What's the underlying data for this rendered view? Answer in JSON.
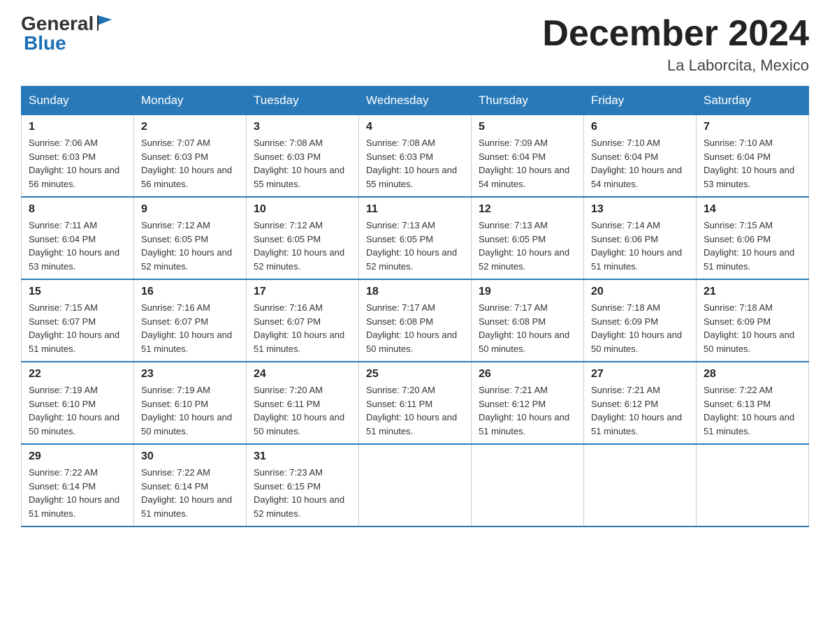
{
  "header": {
    "logo_general": "General",
    "logo_blue": "Blue",
    "title": "December 2024",
    "subtitle": "La Laborcita, Mexico"
  },
  "days_of_week": [
    "Sunday",
    "Monday",
    "Tuesday",
    "Wednesday",
    "Thursday",
    "Friday",
    "Saturday"
  ],
  "weeks": [
    [
      {
        "day": "1",
        "sunrise": "7:06 AM",
        "sunset": "6:03 PM",
        "daylight": "10 hours and 56 minutes."
      },
      {
        "day": "2",
        "sunrise": "7:07 AM",
        "sunset": "6:03 PM",
        "daylight": "10 hours and 56 minutes."
      },
      {
        "day": "3",
        "sunrise": "7:08 AM",
        "sunset": "6:03 PM",
        "daylight": "10 hours and 55 minutes."
      },
      {
        "day": "4",
        "sunrise": "7:08 AM",
        "sunset": "6:03 PM",
        "daylight": "10 hours and 55 minutes."
      },
      {
        "day": "5",
        "sunrise": "7:09 AM",
        "sunset": "6:04 PM",
        "daylight": "10 hours and 54 minutes."
      },
      {
        "day": "6",
        "sunrise": "7:10 AM",
        "sunset": "6:04 PM",
        "daylight": "10 hours and 54 minutes."
      },
      {
        "day": "7",
        "sunrise": "7:10 AM",
        "sunset": "6:04 PM",
        "daylight": "10 hours and 53 minutes."
      }
    ],
    [
      {
        "day": "8",
        "sunrise": "7:11 AM",
        "sunset": "6:04 PM",
        "daylight": "10 hours and 53 minutes."
      },
      {
        "day": "9",
        "sunrise": "7:12 AM",
        "sunset": "6:05 PM",
        "daylight": "10 hours and 52 minutes."
      },
      {
        "day": "10",
        "sunrise": "7:12 AM",
        "sunset": "6:05 PM",
        "daylight": "10 hours and 52 minutes."
      },
      {
        "day": "11",
        "sunrise": "7:13 AM",
        "sunset": "6:05 PM",
        "daylight": "10 hours and 52 minutes."
      },
      {
        "day": "12",
        "sunrise": "7:13 AM",
        "sunset": "6:05 PM",
        "daylight": "10 hours and 52 minutes."
      },
      {
        "day": "13",
        "sunrise": "7:14 AM",
        "sunset": "6:06 PM",
        "daylight": "10 hours and 51 minutes."
      },
      {
        "day": "14",
        "sunrise": "7:15 AM",
        "sunset": "6:06 PM",
        "daylight": "10 hours and 51 minutes."
      }
    ],
    [
      {
        "day": "15",
        "sunrise": "7:15 AM",
        "sunset": "6:07 PM",
        "daylight": "10 hours and 51 minutes."
      },
      {
        "day": "16",
        "sunrise": "7:16 AM",
        "sunset": "6:07 PM",
        "daylight": "10 hours and 51 minutes."
      },
      {
        "day": "17",
        "sunrise": "7:16 AM",
        "sunset": "6:07 PM",
        "daylight": "10 hours and 51 minutes."
      },
      {
        "day": "18",
        "sunrise": "7:17 AM",
        "sunset": "6:08 PM",
        "daylight": "10 hours and 50 minutes."
      },
      {
        "day": "19",
        "sunrise": "7:17 AM",
        "sunset": "6:08 PM",
        "daylight": "10 hours and 50 minutes."
      },
      {
        "day": "20",
        "sunrise": "7:18 AM",
        "sunset": "6:09 PM",
        "daylight": "10 hours and 50 minutes."
      },
      {
        "day": "21",
        "sunrise": "7:18 AM",
        "sunset": "6:09 PM",
        "daylight": "10 hours and 50 minutes."
      }
    ],
    [
      {
        "day": "22",
        "sunrise": "7:19 AM",
        "sunset": "6:10 PM",
        "daylight": "10 hours and 50 minutes."
      },
      {
        "day": "23",
        "sunrise": "7:19 AM",
        "sunset": "6:10 PM",
        "daylight": "10 hours and 50 minutes."
      },
      {
        "day": "24",
        "sunrise": "7:20 AM",
        "sunset": "6:11 PM",
        "daylight": "10 hours and 50 minutes."
      },
      {
        "day": "25",
        "sunrise": "7:20 AM",
        "sunset": "6:11 PM",
        "daylight": "10 hours and 51 minutes."
      },
      {
        "day": "26",
        "sunrise": "7:21 AM",
        "sunset": "6:12 PM",
        "daylight": "10 hours and 51 minutes."
      },
      {
        "day": "27",
        "sunrise": "7:21 AM",
        "sunset": "6:12 PM",
        "daylight": "10 hours and 51 minutes."
      },
      {
        "day": "28",
        "sunrise": "7:22 AM",
        "sunset": "6:13 PM",
        "daylight": "10 hours and 51 minutes."
      }
    ],
    [
      {
        "day": "29",
        "sunrise": "7:22 AM",
        "sunset": "6:14 PM",
        "daylight": "10 hours and 51 minutes."
      },
      {
        "day": "30",
        "sunrise": "7:22 AM",
        "sunset": "6:14 PM",
        "daylight": "10 hours and 51 minutes."
      },
      {
        "day": "31",
        "sunrise": "7:23 AM",
        "sunset": "6:15 PM",
        "daylight": "10 hours and 52 minutes."
      },
      null,
      null,
      null,
      null
    ]
  ],
  "labels": {
    "sunrise": "Sunrise:",
    "sunset": "Sunset:",
    "daylight": "Daylight:"
  }
}
